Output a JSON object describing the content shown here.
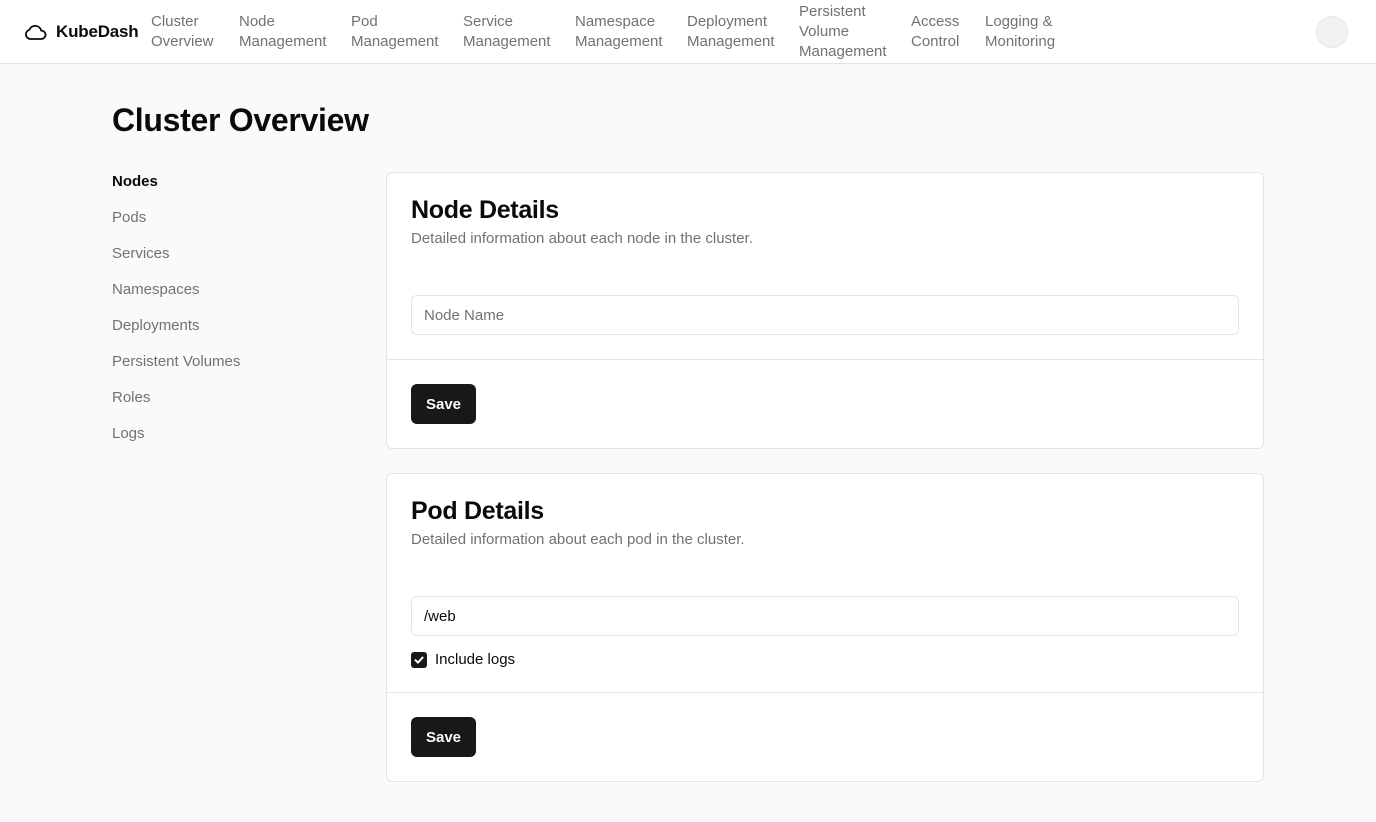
{
  "app": {
    "name": "KubeDash",
    "logo_icon": "cloud-icon"
  },
  "topnav": {
    "items": [
      {
        "label": "Cluster\nOverview"
      },
      {
        "label": "Node\nManagement"
      },
      {
        "label": "Pod\nManagement"
      },
      {
        "label": "Service\nManagement"
      },
      {
        "label": "Namespace\nManagement"
      },
      {
        "label": "Deployment\nManagement"
      },
      {
        "label": "Persistent\nVolume\nManagement"
      },
      {
        "label": "Access\nControl"
      },
      {
        "label": "Logging &\nMonitoring"
      }
    ]
  },
  "page": {
    "title": "Cluster Overview"
  },
  "sidebar": {
    "active_index": 0,
    "items": [
      {
        "label": "Nodes"
      },
      {
        "label": "Pods"
      },
      {
        "label": "Services"
      },
      {
        "label": "Namespaces"
      },
      {
        "label": "Deployments"
      },
      {
        "label": "Persistent Volumes"
      },
      {
        "label": "Roles"
      },
      {
        "label": "Logs"
      }
    ]
  },
  "node_card": {
    "title": "Node Details",
    "description": "Detailed information about each node in the cluster.",
    "input_value": "",
    "input_placeholder": "Node Name",
    "save_label": "Save"
  },
  "pod_card": {
    "title": "Pod Details",
    "description": "Detailed information about each pod in the cluster.",
    "input_value": "/web",
    "include_logs_label": "Include logs",
    "include_logs_checked": true,
    "save_label": "Save"
  },
  "colors": {
    "background": "#f9faf9",
    "primary_button": "#18181b",
    "muted_text": "#71717a",
    "border": "#e4e4e7"
  }
}
